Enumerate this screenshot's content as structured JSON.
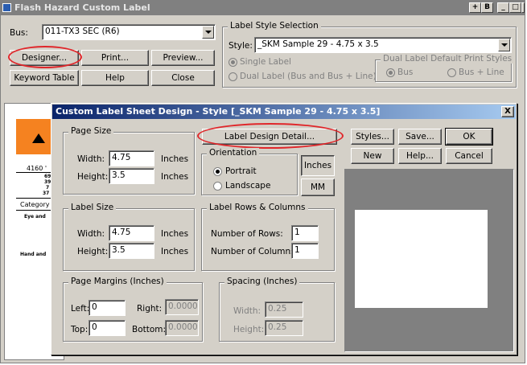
{
  "main": {
    "title": "Flash Hazard Custom Label",
    "bus_label": "Bus:",
    "bus_value": "011-TX3 SEC  (R6)",
    "buttons": {
      "designer": "Designer...",
      "print": "Print...",
      "preview": "Preview...",
      "keyword_table": "Keyword Table",
      "help": "Help",
      "close": "Close"
    },
    "style_group": {
      "title": "Label Style Selection",
      "style_label": "Style:",
      "style_value": "_SKM Sample 29 - 4.75 x 3.5",
      "single_label": "Single Label",
      "dual_label": "Dual Label (Bus and Bus + Line)"
    },
    "dual_group": {
      "title": "Dual Label Default Print Styles",
      "bus": "Bus",
      "bus_line": "Bus + Line"
    },
    "title_buttons": [
      "+",
      "B",
      "_",
      "□",
      "X"
    ]
  },
  "bg_label": {
    "voltage": "4160 '",
    "lines": [
      "69 I",
      "39 I",
      "7 I",
      "37 I I"
    ],
    "category": "Category",
    "eye": "Eye and",
    "hand": "Hand and"
  },
  "dialog": {
    "title": "Custom Label Sheet Design - Style [_SKM Sample 29 - 4.75 x 3.5]",
    "close": "X",
    "label_design_detail": "Label Design Detail...",
    "page_size": {
      "title": "Page Size",
      "width_label": "Width:",
      "width_value": "4.75",
      "height_label": "Height:",
      "height_value": "3.5",
      "unit": "Inches"
    },
    "orientation": {
      "title": "Orientation",
      "portrait": "Portrait",
      "landscape": "Landscape"
    },
    "units": {
      "inches": "Inches",
      "mm": "MM"
    },
    "label_size": {
      "title": "Label Size",
      "width_label": "Width:",
      "width_value": "4.75",
      "height_label": "Height:",
      "height_value": "3.5",
      "unit": "Inches"
    },
    "rows_cols": {
      "title": "Label Rows & Columns",
      "rows_label": "Number of Rows:",
      "rows_value": "1",
      "cols_label": "Number of Columns:",
      "cols_value": "1"
    },
    "margins": {
      "title": "Page Margins (Inches)",
      "left_label": "Left:",
      "left_value": "0",
      "right_label": "Right:",
      "right_value": "0.0000",
      "top_label": "Top:",
      "top_value": "0",
      "bottom_label": "Bottom:",
      "bottom_value": "0.0000"
    },
    "spacing": {
      "title": "Spacing (Inches)",
      "width_label": "Width:",
      "width_value": "0.25",
      "height_label": "Height:",
      "height_value": "0.25"
    },
    "buttons": {
      "styles": "Styles...",
      "save": "Save...",
      "ok": "OK",
      "new": "New",
      "help": "Help...",
      "cancel": "Cancel"
    }
  },
  "colors": {
    "highlight_ellipse": "#e0262a",
    "hazard_orange": "#f58220",
    "dialog_title_start": "#0a246a"
  }
}
